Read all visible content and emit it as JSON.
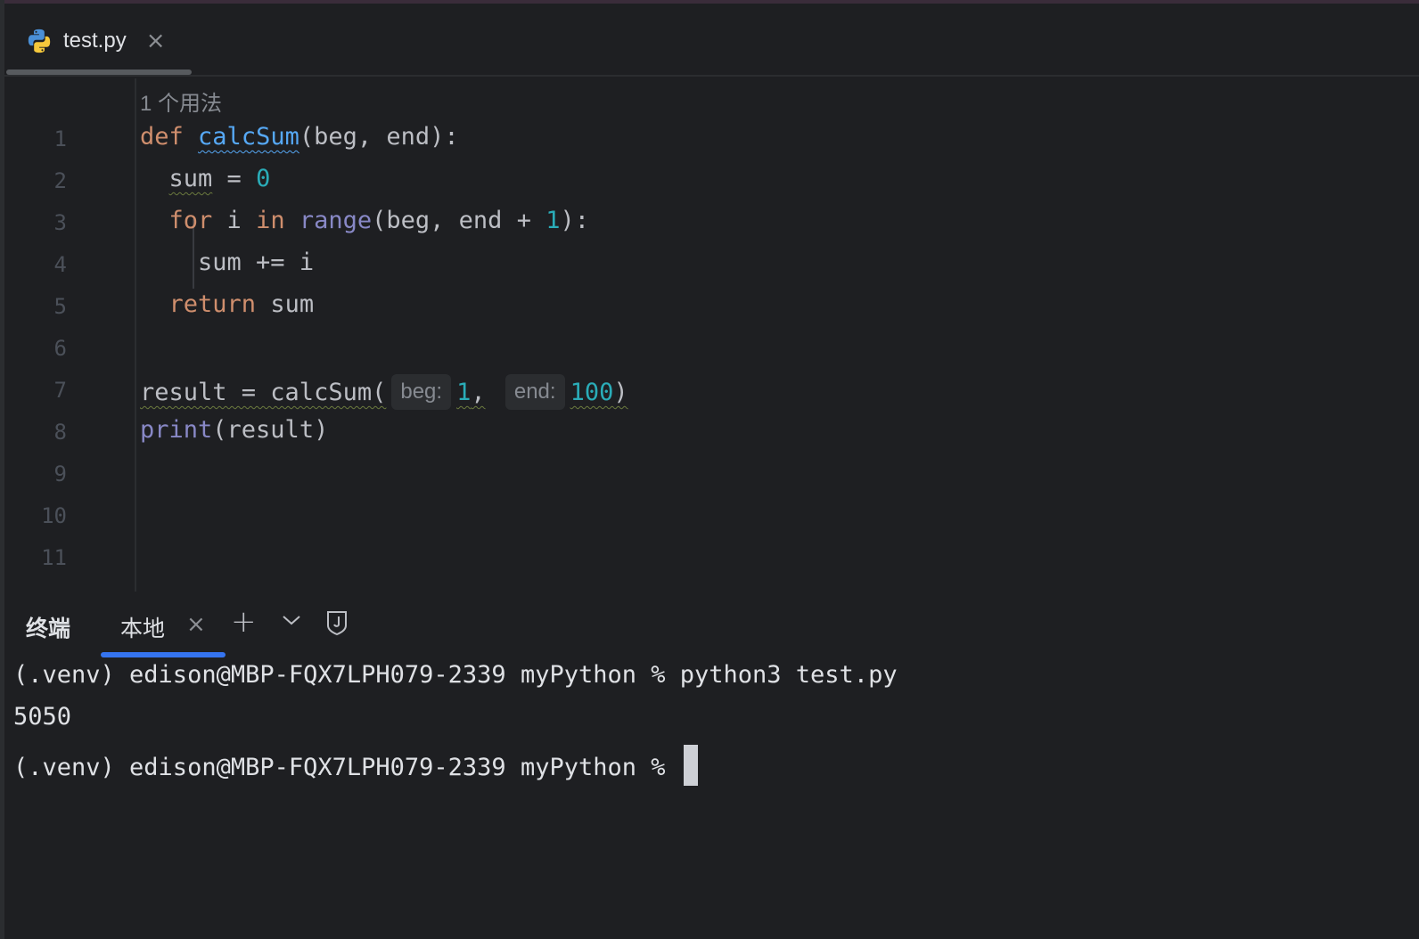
{
  "editor_tab": {
    "filename": "test.py",
    "close_glyph": "×",
    "icon": "python-icon"
  },
  "usage_hint": "1 个用法",
  "code": {
    "lines": [
      {
        "num": "1"
      },
      {
        "num": "2"
      },
      {
        "num": "3"
      },
      {
        "num": "4"
      },
      {
        "num": "5"
      },
      {
        "num": "6"
      },
      {
        "num": "7"
      },
      {
        "num": "8"
      },
      {
        "num": "9"
      },
      {
        "num": "10"
      },
      {
        "num": "11"
      }
    ],
    "l1": {
      "kw": "def",
      "fn": "calcSum",
      "rest": "(beg, end):"
    },
    "l2": {
      "var": "sum",
      "op": " = ",
      "num": "0"
    },
    "l3": {
      "kw1": "for",
      "mid1": " i ",
      "kw2": "in",
      "sp": " ",
      "bi": "range",
      "rest": "(beg, end + ",
      "num": "1",
      "end": "):"
    },
    "l4": {
      "text": "sum += i"
    },
    "l5": {
      "kw": "return",
      "rest": " sum"
    },
    "l7": {
      "lhs": "result = calcSum(",
      "hint1": "beg:",
      "arg1": "1",
      "comma": ",",
      "hint2": "end:",
      "arg2": "100",
      "close": ")"
    },
    "l8": {
      "bi": "print",
      "rest": "(result)"
    }
  },
  "terminal": {
    "title": "终端",
    "tab_label": "本地",
    "tab_close": "×",
    "add_glyph": "+",
    "lines": [
      "(.venv) edison@MBP-FQX7LPH079-2339 myPython % python3 test.py",
      "5050",
      "(.venv) edison@MBP-FQX7LPH079-2339 myPython % "
    ]
  },
  "colors": {
    "background": "#1e1f22",
    "keyword": "#cf8e6d",
    "function": "#56a8f5",
    "number": "#2aacb8",
    "builtin": "#8888c6",
    "accent": "#3574f0"
  }
}
